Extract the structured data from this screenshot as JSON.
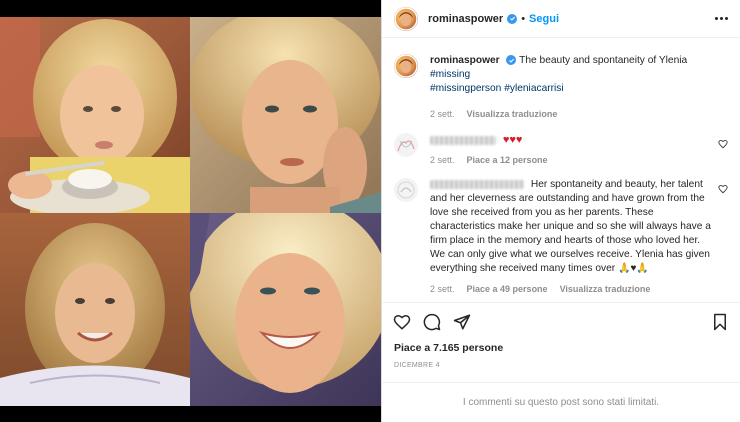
{
  "header": {
    "username": "rominaspower",
    "separator": "•",
    "follow_label": "Segui"
  },
  "caption": {
    "username": "rominaspower",
    "text": "The beauty and spontaneity of Ylenia",
    "hashtag_1": "#missing",
    "hashtag_2": "#missingperson",
    "hashtag_3": "#yleniacarrisi",
    "time": "2 sett.",
    "translate": "Visualizza traduzione"
  },
  "comment_1": {
    "hearts": "♥♥♥",
    "time": "2 sett.",
    "likes": "Piace a 12 persone"
  },
  "comment_2": {
    "text": "Her spontaneity and beauty, her talent and her cleverness are outstanding and have grown from the love she received from you as her parents. These characteristics make her unique and so she will always have a firm place in the memory and hearts of those who loved her. We can only give what we ourselves receive. Ylenia has given everything she received many times over",
    "emoji": "🙏♥🙏",
    "time": "2 sett.",
    "likes": "Piace a 49 persone",
    "translate": "Visualizza traduzione"
  },
  "post": {
    "likes": "Piace a 7.165 persone",
    "date": "DICEMBRE 4",
    "comments_limited": "I commenti su questo post sono stati limitati."
  },
  "icons": {
    "like": "heart-icon",
    "comment": "comment-icon",
    "share": "share-icon",
    "save": "bookmark-icon",
    "more": "more-icon",
    "verified": "verified-badge-icon"
  },
  "colors": {
    "link_blue": "#0095f6",
    "hashtag": "#00376b",
    "heart_red": "#d81c2a",
    "muted": "#8e8e8e",
    "text": "#262626",
    "verified": "#3897f0"
  }
}
